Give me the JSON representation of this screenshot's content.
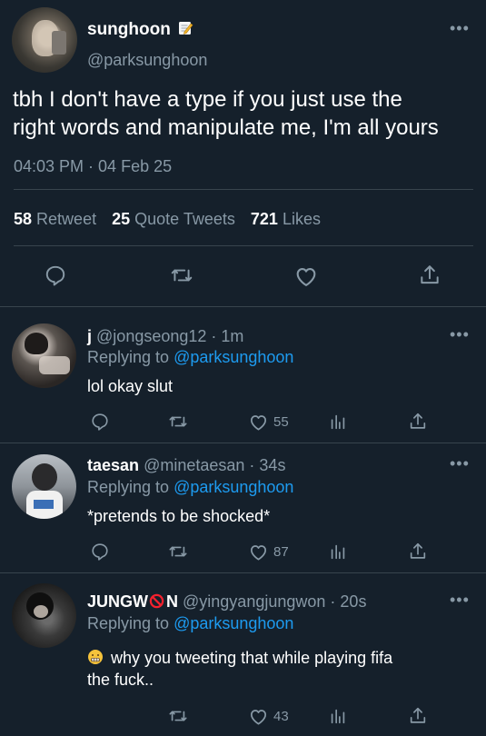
{
  "main_tweet": {
    "name": "sunghoon",
    "handle": "@parksunghoon",
    "text_line1": "tbh I don't have a type if you just use the",
    "text_line2": "right words and manipulate me, I'm all yours",
    "time": "04:03 PM",
    "date": "04 Feb 25",
    "retweets": "58",
    "retweets_label": "Retweet",
    "quotes": "25",
    "quotes_label": "Quote Tweets",
    "likes": "721",
    "likes_label": "Likes"
  },
  "replies": [
    {
      "name": "j",
      "handle": "@jongseong12",
      "time": "· 1m",
      "replying_prefix": "Replying to",
      "replying_handle": "@parksunghoon",
      "text": "lol okay slut",
      "likes": "55"
    },
    {
      "name": "taesan",
      "handle": "@minetaesan",
      "time": "· 34s",
      "replying_prefix": "Replying to",
      "replying_handle": "@parksunghoon",
      "text": "*pretends to be shocked*",
      "likes": "87"
    },
    {
      "name_part1": "JUNGW",
      "name_part2": "N",
      "handle": "@yingyangjungwon",
      "time": "· 20s",
      "replying_prefix": "Replying to",
      "replying_handle": "@parksunghoon",
      "text_line1": "why you tweeting that while playing fifa",
      "text_line2": "the fuck..",
      "likes": "43"
    }
  ],
  "icons": [
    "memo-icon",
    "more-icon",
    "reply-icon",
    "retweet-icon",
    "like-icon",
    "share-icon",
    "analytics-icon",
    "prohibited-icon",
    "grimace-emoji-icon"
  ],
  "colors": {
    "background": "#15202b",
    "text": "#ffffff",
    "muted": "#8899a6",
    "link": "#1d9bf0",
    "divider": "#38444d"
  }
}
